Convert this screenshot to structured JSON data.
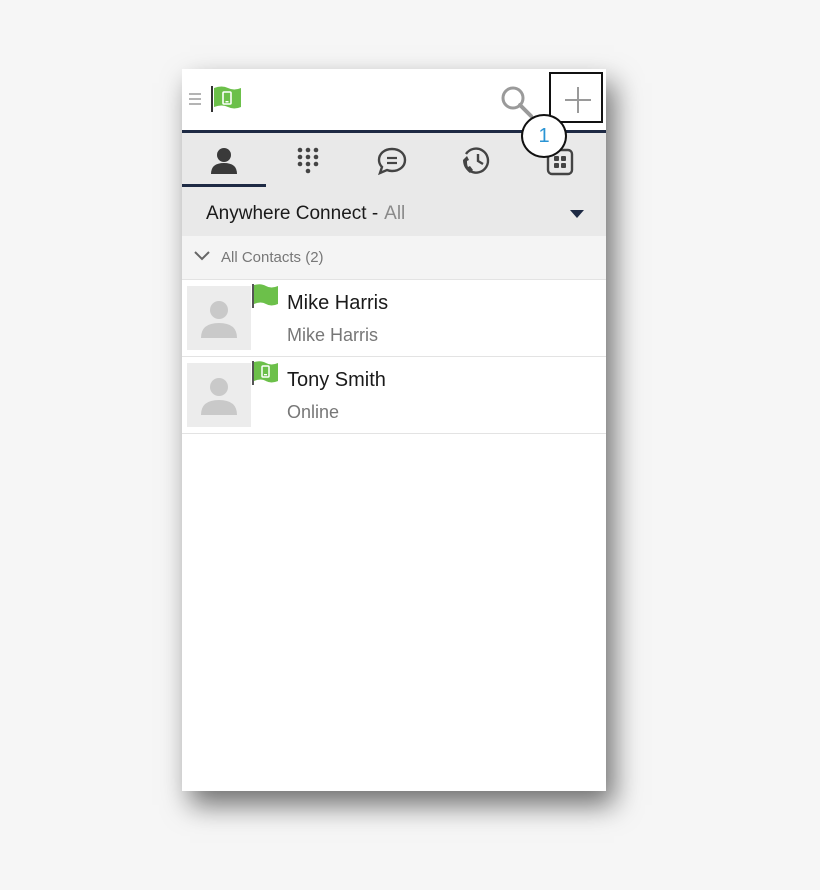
{
  "app": {
    "brand_color": "#6cc04a",
    "accent_color": "#1e2a44",
    "callout_color": "#2a94d4"
  },
  "header": {
    "menu_icon": "hamburger-icon",
    "logo_icon": "green-flag-mobile-icon",
    "search_icon": "search-icon",
    "add_icon": "plus-icon",
    "callout_number": "1"
  },
  "tabs": [
    {
      "name": "contacts",
      "icon": "person-icon",
      "active": true
    },
    {
      "name": "dialpad",
      "icon": "dialpad-icon",
      "active": false
    },
    {
      "name": "chat",
      "icon": "chat-bubble-icon",
      "active": false
    },
    {
      "name": "history",
      "icon": "call-history-icon",
      "active": false
    },
    {
      "name": "more",
      "icon": "apps-icon",
      "active": false
    }
  ],
  "filter": {
    "label": "Anywhere Connect -",
    "value": "All"
  },
  "group": {
    "label": "All Contacts (2)"
  },
  "contacts": [
    {
      "name": "Mike Harris",
      "subtitle": "Mike Harris",
      "presence": "green-flag-icon"
    },
    {
      "name": "Tony Smith",
      "subtitle": "Online",
      "presence": "green-flag-mobile-icon"
    }
  ]
}
